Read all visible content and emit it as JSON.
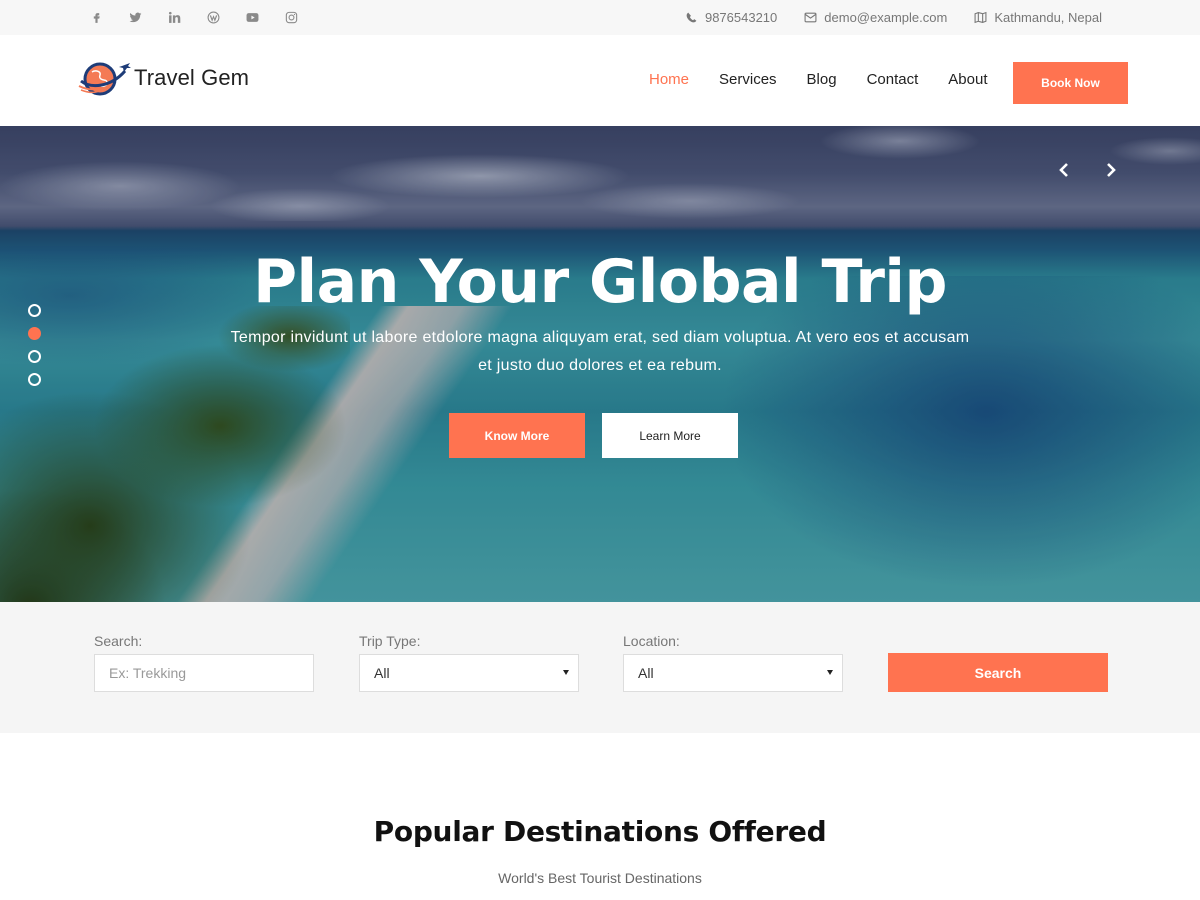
{
  "topbar": {
    "social": [
      {
        "name": "facebook-icon"
      },
      {
        "name": "twitter-icon"
      },
      {
        "name": "linkedin-icon"
      },
      {
        "name": "wordpress-icon"
      },
      {
        "name": "youtube-icon"
      },
      {
        "name": "instagram-icon"
      }
    ],
    "phone": "9876543210",
    "email": "demo@example.com",
    "location": "Kathmandu, Nepal"
  },
  "header": {
    "logo_text": "Travel Gem",
    "nav": [
      {
        "label": "Home",
        "active": true
      },
      {
        "label": "Services",
        "active": false
      },
      {
        "label": "Blog",
        "active": false
      },
      {
        "label": "Contact",
        "active": false
      },
      {
        "label": "About",
        "active": false
      }
    ],
    "book_label": "Book Now"
  },
  "hero": {
    "title": "Plan Your Global Trip",
    "subtitle": "Tempor invidunt ut labore etdolore magna aliquyam erat, sed diam voluptua. At vero eos et accusam et justo duo dolores et ea rebum.",
    "primary_label": "Know More",
    "secondary_label": "Learn More",
    "slides_count": 4,
    "active_slide": 2
  },
  "search": {
    "search_label": "Search:",
    "search_placeholder": "Ex: Trekking",
    "trip_type_label": "Trip Type:",
    "trip_type_value": "All",
    "location_label": "Location:",
    "location_value": "All",
    "button_label": "Search"
  },
  "section": {
    "title": "Popular Destinations Offered",
    "subtitle": "World's Best Tourist Destinations"
  },
  "colors": {
    "accent": "#ff7350",
    "topbar_bg": "#f7f7f7",
    "search_bg": "#f5f5f5"
  }
}
